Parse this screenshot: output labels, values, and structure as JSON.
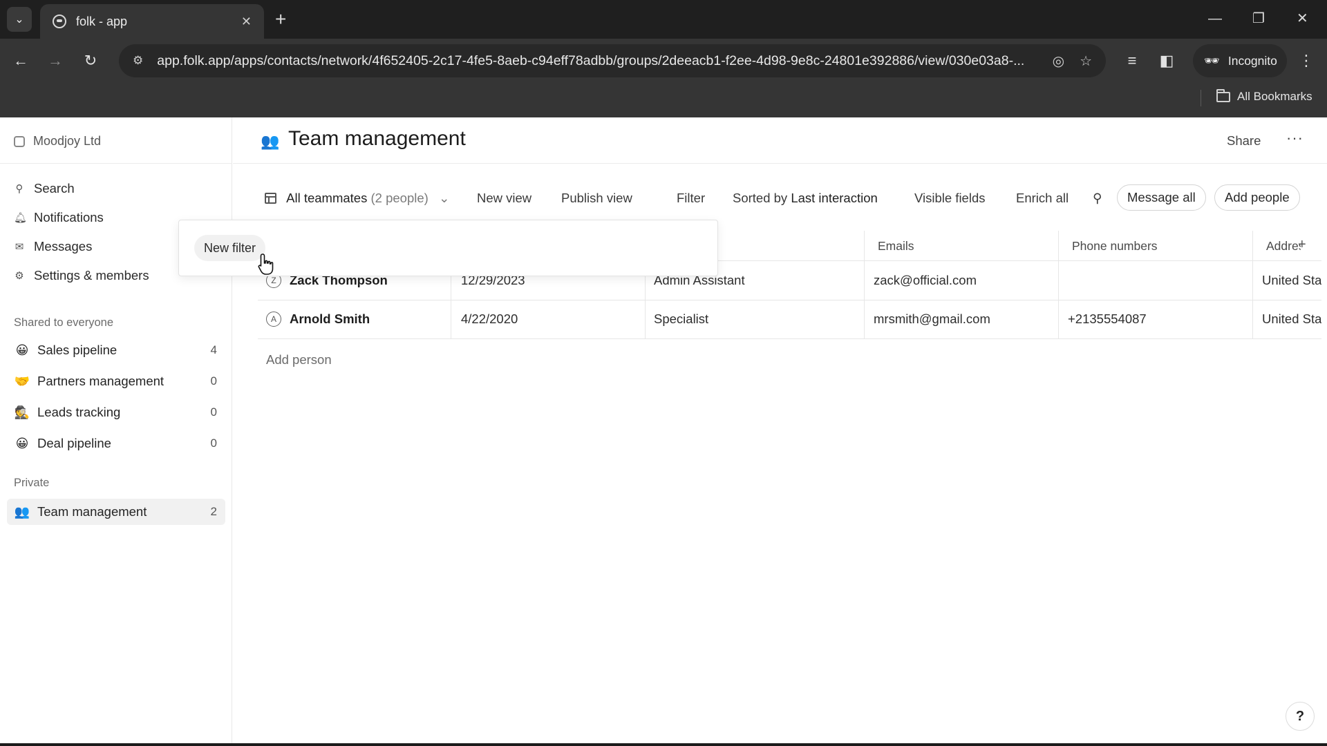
{
  "browser": {
    "tab_title": "folk - app",
    "url": "app.folk.app/apps/contacts/network/4f652405-2c17-4fe5-8aeb-c94eff78adbb/groups/2deeacb1-f2ee-4d98-9e8c-24801e392886/view/030e03a8-...",
    "incognito_label": "Incognito",
    "bookmarks_label": "All Bookmarks"
  },
  "sidebar": {
    "workspace": "Moodjoy Ltd",
    "nav": [
      {
        "label": "Search",
        "icon": "search-icon"
      },
      {
        "label": "Notifications",
        "icon": "bell-icon"
      },
      {
        "label": "Messages",
        "icon": "mail-icon"
      },
      {
        "label": "Settings & members",
        "icon": "gear-icon"
      }
    ],
    "shared_label": "Shared to everyone",
    "shared_groups": [
      {
        "emoji": "😀",
        "label": "Sales pipeline",
        "count": "4"
      },
      {
        "emoji": "🤝",
        "label": "Partners management",
        "count": "0"
      },
      {
        "emoji": "🕵",
        "label": "Leads tracking",
        "count": "0"
      },
      {
        "emoji": "😀",
        "label": "Deal pipeline",
        "count": "0"
      }
    ],
    "private_label": "Private",
    "private_groups": [
      {
        "emoji": "👥",
        "label": "Team management",
        "count": "2"
      }
    ]
  },
  "header": {
    "title": "Team management",
    "share_label": "Share",
    "more_label": "···"
  },
  "viewbar": {
    "view_name": "All teammates",
    "view_count": "(2 people)",
    "new_view": "New view",
    "publish_view": "Publish view",
    "filter": "Filter",
    "sorted_prefix": "Sorted by",
    "sorted_field": "Last interaction",
    "visible_fields": "Visible fields",
    "enrich_all": "Enrich all",
    "message_all": "Message all",
    "add_people": "Add people"
  },
  "table": {
    "columns": [
      "Emails",
      "Phone numbers",
      "Addresses"
    ],
    "rows": [
      {
        "initial": "Z",
        "name": "Zack Thompson",
        "date": "12/29/2023",
        "role": "Admin Assistant",
        "email": "zack@official.com",
        "phone": "",
        "address": "United Sta"
      },
      {
        "initial": "A",
        "name": "Arnold Smith",
        "date": "4/22/2020",
        "role": "Specialist",
        "email": "mrsmith@gmail.com",
        "phone": "+2135554087",
        "address": "United Sta"
      }
    ],
    "add_person": "Add person"
  },
  "popover": {
    "new_filter": "New filter"
  },
  "help_label": "?"
}
